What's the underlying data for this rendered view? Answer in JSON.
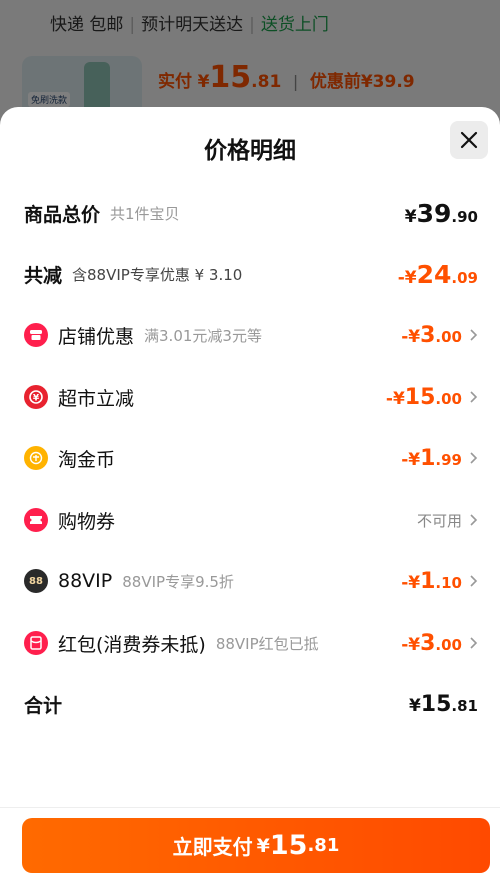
{
  "background": {
    "shipping": {
      "free": "快递 包邮",
      "eta": "预计明天送达",
      "delivery": "送货上门"
    },
    "product_tag": "免刷洗款",
    "price_label": "实付",
    "price_currency": "¥",
    "price_int": "15",
    "price_dec": ".81",
    "before_label": "优惠前",
    "before_price": "¥39.9"
  },
  "sheet": {
    "title": "价格明细",
    "rows": [
      {
        "name": "商品总价",
        "sub": "共1件宝贝",
        "currency": "¥",
        "int": "39",
        "dec": ".90"
      },
      {
        "name": "共减",
        "sub": "含88VIP专享优惠 ¥ 3.10",
        "currency": "-¥",
        "int": "24",
        "dec": ".09"
      },
      {
        "name": "店铺优惠",
        "sub": "满3.01元减3元等",
        "currency": "-¥",
        "int": "3",
        "dec": ".00",
        "icon": "shop-icon",
        "color": "#ff1f4d"
      },
      {
        "name": "超市立减",
        "sub": "",
        "currency": "-¥",
        "int": "15",
        "dec": ".00",
        "icon": "supermarket-icon",
        "color": "#e8222f"
      },
      {
        "name": "淘金币",
        "sub": "",
        "currency": "-¥",
        "int": "1",
        "dec": ".99",
        "icon": "gold-coin-icon",
        "color": "#ffb300"
      },
      {
        "name": "购物券",
        "sub": "",
        "status": "不可用",
        "icon": "coupon-icon",
        "color": "#ff1f4d"
      },
      {
        "name": "88VIP",
        "sub": "88VIP专享9.5折",
        "currency": "-¥",
        "int": "1",
        "dec": ".10",
        "icon": "vip-88-icon",
        "badge": "88",
        "color": "#2a2a2a"
      },
      {
        "name": "红包(消费券未抵)",
        "sub": "88VIP红包已抵",
        "currency": "-¥",
        "int": "3",
        "dec": ".00",
        "icon": "red-packet-icon",
        "color": "#ff1f4d"
      }
    ],
    "total": {
      "name": "合计",
      "currency": "¥",
      "int": "15",
      "dec": ".81"
    }
  },
  "pay_button": {
    "label": "立即支付",
    "currency": "¥",
    "int": "15",
    "dec": ".81"
  }
}
